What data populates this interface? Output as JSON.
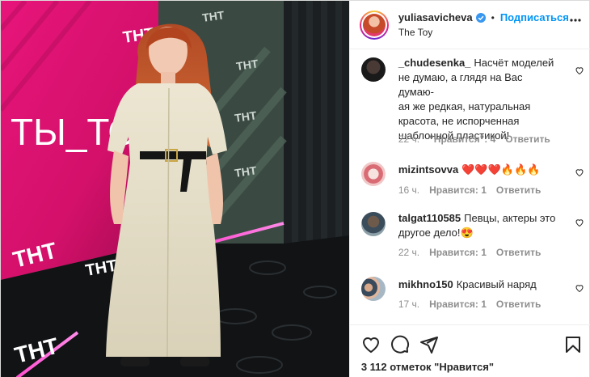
{
  "post": {
    "username": "yuliasavicheva",
    "follow_label": "Подписаться",
    "location": "The Toy",
    "likes_text": "3 112 отметок \"Нравится\""
  },
  "photo": {
    "backdrop_text": "ТЫ_ТО",
    "logo_text": "ТНТ"
  },
  "comments": [
    {
      "user": "_chudesenka_",
      "text": "Насчёт моделей не думаю, а глядя на Вас думаю- ая же редкая, натуральная красота, не испорченная шаблонной пластикой!",
      "text_lines": [
        "_chudesenka_ Насчёт моделей",
        "не думаю, а глядя на Вас думаю-",
        "ая же редкая, натуральная",
        "красота, не испорченная",
        "шаблонной пластикой!"
      ],
      "time": "22 ч.",
      "likes": "\"Нравится\": 4",
      "reply": "Ответить"
    },
    {
      "user": "mizintsovva",
      "text": "❤️❤️❤️🔥🔥🔥",
      "time": "16 ч.",
      "likes": "Нравится: 1",
      "reply": "Ответить"
    },
    {
      "user": "talgat110585",
      "text": "Певцы, актеры это другое дело!😍",
      "text_line2": "другое дело!😍",
      "text_line1": "Певцы, актеры это",
      "time": "22 ч.",
      "likes": "Нравится: 1",
      "reply": "Ответить"
    },
    {
      "user": "mikhno150",
      "text": "Красивый наряд",
      "time": "17 ч.",
      "likes": "Нравится: 1",
      "reply": "Ответить"
    }
  ],
  "icons": {
    "heart": "heart-icon",
    "comment": "comment-icon",
    "share": "share-icon",
    "save": "bookmark-icon",
    "verified": "verified-badge-icon",
    "more": "more-options-icon"
  },
  "colors": {
    "accent": "#0095f6",
    "pink_backdrop": "#e0146f",
    "text": "#262626",
    "muted": "#8e8e8e"
  }
}
